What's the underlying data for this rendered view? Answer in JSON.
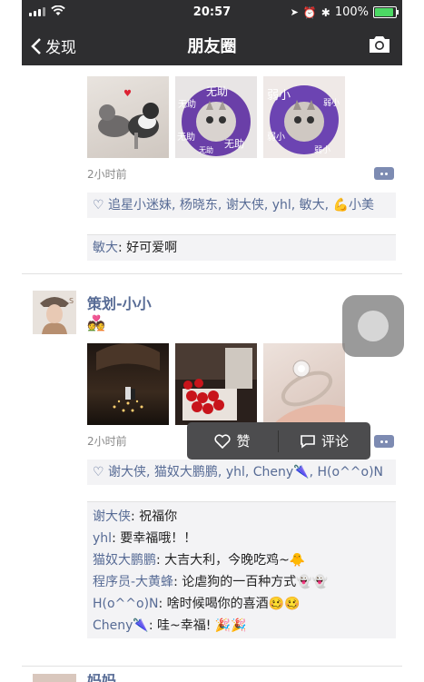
{
  "status": {
    "time": "20:57",
    "battery": "100%"
  },
  "nav": {
    "back_label": "发现",
    "title": "朋友圈"
  },
  "post1": {
    "time": "2小时前",
    "likes_text": "追星小迷妹, 杨晓东, 谢大侠, yhl, 敏大, 💪小美",
    "comments": [
      {
        "user": "敏大",
        "text": ": 好可爱啊"
      }
    ],
    "image_texts": [
      "无助",
      "无助",
      "无助",
      "无助",
      "无助",
      "弱小",
      "弱小",
      "弱小",
      "弱小"
    ]
  },
  "post2": {
    "username": "策划-小小",
    "emoji": "💑",
    "time": "2小时前",
    "likes_text": "谢大侠, 猫奴大鹏鹏, yhl, Cheny🌂, H(o^^o)N",
    "comments": [
      {
        "user": "谢大侠",
        "text": ": 祝福你"
      },
      {
        "user": "yhl",
        "text": ": 要幸福哦！！"
      },
      {
        "user": "猫奴大鹏鹏",
        "text": ": 大吉大利，今晚吃鸡~🐥"
      },
      {
        "user": "程序员-大黄蜂",
        "text": ": 论虐狗的一百种方式👻👻"
      },
      {
        "user": "H(o^^o)N",
        "text": ": 啥时候喝你的喜酒🥴🥴"
      },
      {
        "user": "Cheny🌂",
        "text": ": 哇~幸福! 🎉🎉"
      }
    ]
  },
  "popup": {
    "like_label": "赞",
    "comment_label": "评论"
  },
  "post3": {
    "username": "妈妈"
  },
  "colors": {
    "bar": "#2e2e30",
    "link": "#576b95",
    "comment_bg": "#f3f3f5"
  }
}
